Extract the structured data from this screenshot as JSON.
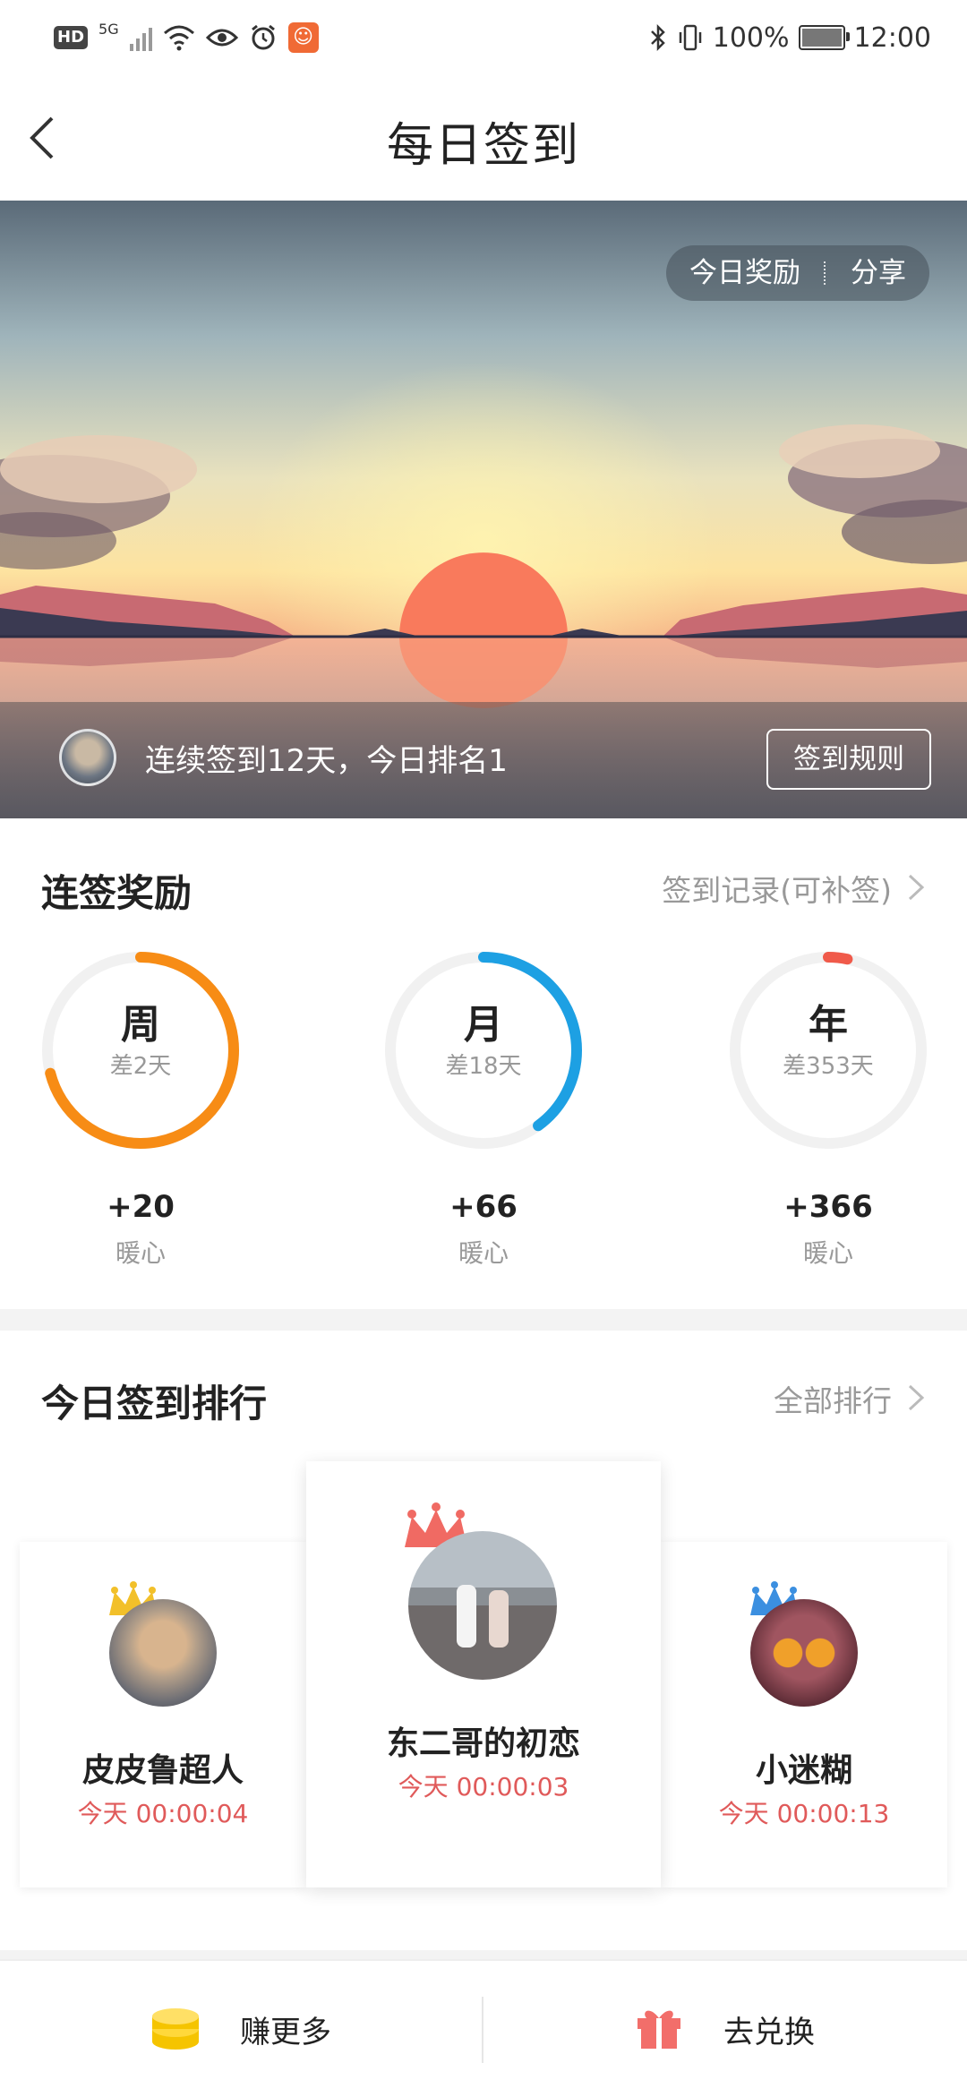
{
  "status_bar": {
    "hd": "HD",
    "network": "5G",
    "battery_pct": "100%",
    "time": "12:00"
  },
  "header": {
    "title": "每日签到"
  },
  "banner": {
    "reward_label": "今日奖励",
    "share_label": "分享",
    "streak_text": "连续签到12天，今日排名1",
    "rules_label": "签到规则"
  },
  "streak": {
    "title": "连签奖励",
    "record_link": "签到记录(可补签)",
    "items": [
      {
        "label": "周",
        "remaining": "差2天",
        "reward": "+20",
        "unit": "暖心",
        "progress": 0.71,
        "color": "#f78c15"
      },
      {
        "label": "月",
        "remaining": "差18天",
        "reward": "+66",
        "unit": "暖心",
        "progress": 0.4,
        "color": "#1da0e3"
      },
      {
        "label": "年",
        "remaining": "差353天",
        "reward": "+366",
        "unit": "暖心",
        "progress": 0.033,
        "color": "#f05a4a"
      }
    ]
  },
  "ranking": {
    "title": "今日签到排行",
    "all_link": "全部排行",
    "entries": [
      {
        "name": "皮皮鲁超人",
        "day": "今天",
        "time": "00:00:04"
      },
      {
        "name": "东二哥的初恋",
        "day": "今天",
        "time": "00:00:03"
      },
      {
        "name": "小迷糊",
        "day": "今天",
        "time": "00:00:13"
      }
    ]
  },
  "bottom": {
    "earn_label": "赚更多",
    "redeem_label": "去兑换"
  }
}
